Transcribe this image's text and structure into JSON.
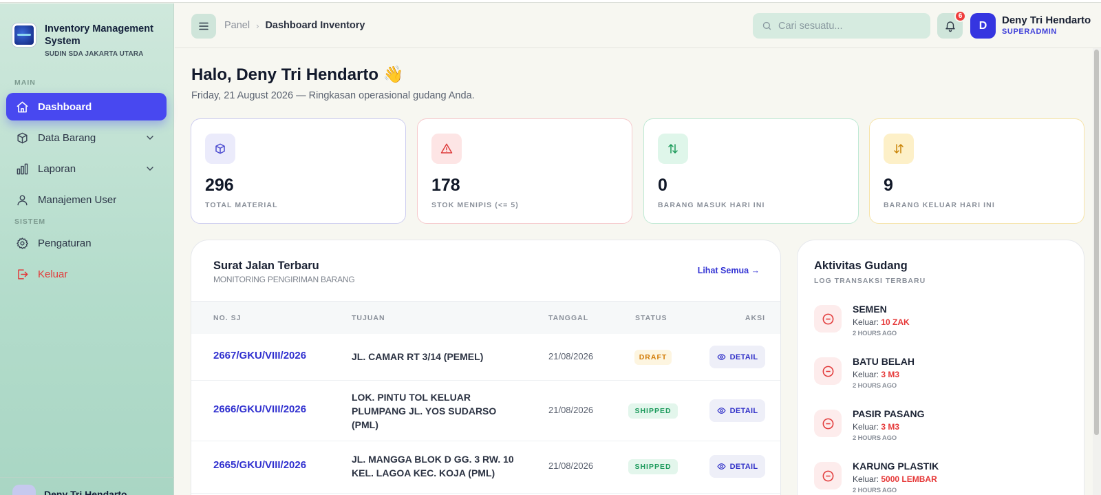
{
  "brand": {
    "title": "Inventory Management System",
    "subtitle": "SUDIN SDA JAKARTA UTARA"
  },
  "sidebar": {
    "section_main": "MAIN",
    "section_system": "SISTEM",
    "items": [
      {
        "label": "Dashboard",
        "icon": "home-icon",
        "active": true
      },
      {
        "label": "Data Barang",
        "icon": "box-icon",
        "has_submenu": true
      },
      {
        "label": "Laporan",
        "icon": "bar-chart-icon",
        "has_submenu": true
      },
      {
        "label": "Manajemen User",
        "icon": "users-icon"
      },
      {
        "label": "Pengaturan",
        "icon": "gear-icon"
      },
      {
        "label": "Keluar",
        "icon": "logout-icon"
      }
    ],
    "user_name": "Deny Tri Hendarto"
  },
  "header": {
    "breadcrumb": [
      "Panel",
      "Dashboard Inventory"
    ],
    "search_placeholder": "Cari sesuatu...",
    "notif_count": "6",
    "avatar_initial": "D",
    "user_name": "Deny Tri Hendarto",
    "user_role": "SUPERADMIN"
  },
  "greeting": {
    "title": "Halo, Deny Tri Hendarto 👋",
    "subtitle": "Friday, 21 August 2026 — Ringkasan operasional gudang Anda."
  },
  "stats": [
    {
      "value": "296",
      "label": "TOTAL MATERIAL",
      "icon": "cube-icon",
      "color": "#5b5bd6"
    },
    {
      "value": "178",
      "label": "STOK MENIPIS (<= 5)",
      "icon": "warning-icon",
      "color": "#e04444"
    },
    {
      "value": "0",
      "label": "BARANG MASUK HARI INI",
      "icon": "arrows-updown-icon",
      "color": "#1f9d5c"
    },
    {
      "value": "9",
      "label": "BARANG KELUAR HARI INI",
      "icon": "arrows-swap-icon",
      "color": "#d08a08"
    }
  ],
  "surat_jalan": {
    "title": "Surat Jalan Terbaru",
    "subtitle": "MONITORING PENGIRIMAN BARANG",
    "view_all": "Lihat Semua →",
    "columns": [
      "NO. SJ",
      "TUJUAN",
      "TANGGAL",
      "STATUS",
      "AKSI"
    ],
    "rows": [
      {
        "no": "2667/GKU/VIII/2026",
        "tujuan": "JL. CAMAR RT 3/14 (PEMEL)",
        "tanggal": "21/08/2026",
        "status": "DRAFT",
        "aksi": "DETAIL"
      },
      {
        "no": "2666/GKU/VIII/2026",
        "tujuan": "LOK. PINTU TOL KELUAR PLUMPANG JL. YOS SUDARSO (PML)",
        "tanggal": "21/08/2026",
        "status": "SHIPPED",
        "aksi": "DETAIL"
      },
      {
        "no": "2665/GKU/VIII/2026",
        "tujuan": "JL. MANGGA BLOK D GG. 3 RW. 10 KEL. LAGOA KEC. KOJA (PML)",
        "tanggal": "21/08/2026",
        "status": "SHIPPED",
        "aksi": "DETAIL"
      }
    ]
  },
  "aktivitas": {
    "title": "Aktivitas Gudang",
    "subtitle": "LOG TRANSAKSI TERBARU",
    "items": [
      {
        "name": "SEMEN",
        "prefix": "Keluar:",
        "qty": "10 ZAK",
        "time": "2 HOURS AGO"
      },
      {
        "name": "BATU BELAH",
        "prefix": "Keluar:",
        "qty": "3 M3",
        "time": "2 HOURS AGO"
      },
      {
        "name": "PASIR PASANG",
        "prefix": "Keluar:",
        "qty": "3 M3",
        "time": "2 HOURS AGO"
      },
      {
        "name": "KARUNG PLASTIK",
        "prefix": "Keluar:",
        "qty": "5000 LEMBAR",
        "time": "2 HOURS AGO"
      }
    ]
  },
  "colors": {
    "accent": "#4848f0",
    "sidebar": "#b3dccb",
    "danger": "#e23b3b"
  }
}
